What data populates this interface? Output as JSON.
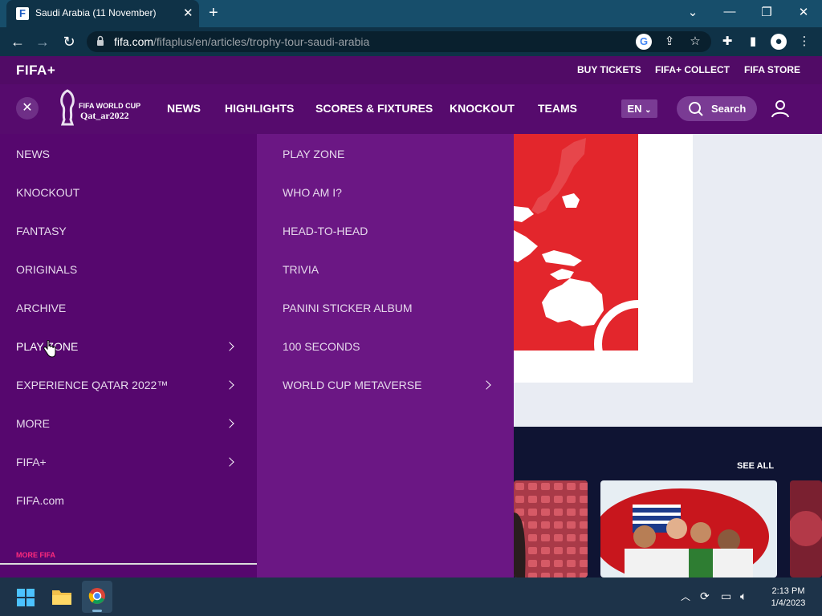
{
  "browser": {
    "tab_title": "Saudi Arabia (11 November)",
    "favicon_letter": "F",
    "url_domain": "fifa.com",
    "url_path": "/fifaplus/en/articles/trophy-tour-saudi-arabia"
  },
  "fifa_top": {
    "logo": "FIFA+",
    "links": [
      "BUY TICKETS",
      "FIFA+ COLLECT",
      "FIFA STORE"
    ]
  },
  "main_nav": {
    "logo_line1": "FIFA WORLD CUP",
    "logo_line2": "Qat_ar2022",
    "items": [
      "NEWS",
      "HIGHLIGHTS",
      "SCORES & FIXTURES",
      "KNOCKOUT",
      "TEAMS"
    ],
    "lang": "EN",
    "search_label": "Search"
  },
  "left_menu": {
    "items": [
      {
        "label": "NEWS",
        "has_arrow": false
      },
      {
        "label": "KNOCKOUT",
        "has_arrow": false
      },
      {
        "label": "FANTASY",
        "has_arrow": false
      },
      {
        "label": "ORIGINALS",
        "has_arrow": false
      },
      {
        "label": "ARCHIVE",
        "has_arrow": false
      },
      {
        "label": "PLAY ZONE",
        "has_arrow": true
      },
      {
        "label": "EXPERIENCE QATAR 2022™",
        "has_arrow": true
      },
      {
        "label": "MORE",
        "has_arrow": true
      },
      {
        "label": "FIFA+",
        "has_arrow": true
      },
      {
        "label": "FIFA.com",
        "has_arrow": false
      }
    ],
    "more_fifa": "MORE FIFA"
  },
  "sub_menu": {
    "items": [
      {
        "label": "PLAY ZONE",
        "has_arrow": false
      },
      {
        "label": "WHO AM I?",
        "has_arrow": false
      },
      {
        "label": "HEAD-TO-HEAD",
        "has_arrow": false
      },
      {
        "label": "TRIVIA",
        "has_arrow": false
      },
      {
        "label": "PANINI STICKER ALBUM",
        "has_arrow": false
      },
      {
        "label": "100 SECONDS",
        "has_arrow": false
      },
      {
        "label": "WORLD CUP METAVERSE",
        "has_arrow": true
      }
    ]
  },
  "content": {
    "see_all": "SEE ALL"
  },
  "taskbar": {
    "time": "2:13 PM",
    "date": "1/4/2023"
  },
  "colors": {
    "fifa_purple": "#560b6d",
    "submenu_purple": "#6b1784",
    "accent_pink": "#ff2b7d",
    "chrome_blue": "#174e6b"
  }
}
